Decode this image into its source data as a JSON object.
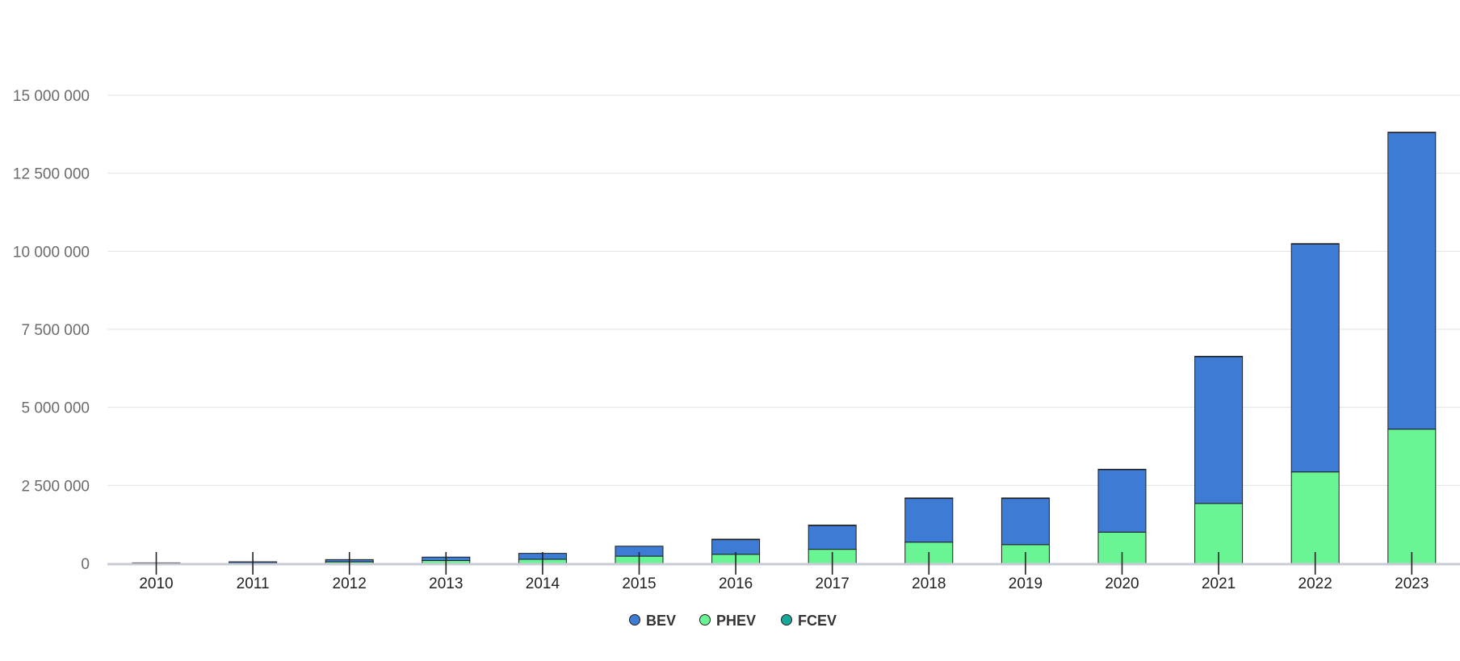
{
  "chart_data": {
    "type": "bar",
    "stacked": true,
    "categories": [
      "2010",
      "2011",
      "2012",
      "2013",
      "2014",
      "2015",
      "2016",
      "2017",
      "2018",
      "2019",
      "2020",
      "2021",
      "2022",
      "2023"
    ],
    "series": [
      {
        "name": "PHEV",
        "color": "#69f594",
        "values": [
          0,
          10000,
          50000,
          90000,
          130000,
          230000,
          290000,
          450000,
          680000,
          600000,
          1000000,
          1920000,
          2930000,
          4300000
        ]
      },
      {
        "name": "BEV",
        "color": "#3d7bd5",
        "values": [
          7000,
          40000,
          70000,
          110000,
          190000,
          320000,
          470000,
          760000,
          1400000,
          1480000,
          2000000,
          4700000,
          7300000,
          9500000
        ]
      },
      {
        "name": "FCEV",
        "color": "#16a89a",
        "values": [
          0,
          0,
          0,
          0,
          0,
          0,
          1000,
          2000,
          3000,
          4000,
          4000,
          10000,
          12000,
          10000
        ]
      }
    ],
    "legend_order": [
      "BEV",
      "PHEV",
      "FCEV"
    ],
    "yticks": [
      0,
      2500000,
      5000000,
      7500000,
      10000000,
      12500000,
      15000000
    ],
    "ytick_labels": [
      "0",
      "2 500 000",
      "5 000 000",
      "7 500 000",
      "10 000 000",
      "12 500 000",
      "15 000 000"
    ],
    "ylim": [
      0,
      15000000
    ],
    "title": "",
    "xlabel": "",
    "ylabel": "",
    "grid": true,
    "legend_position": "bottom-center"
  }
}
